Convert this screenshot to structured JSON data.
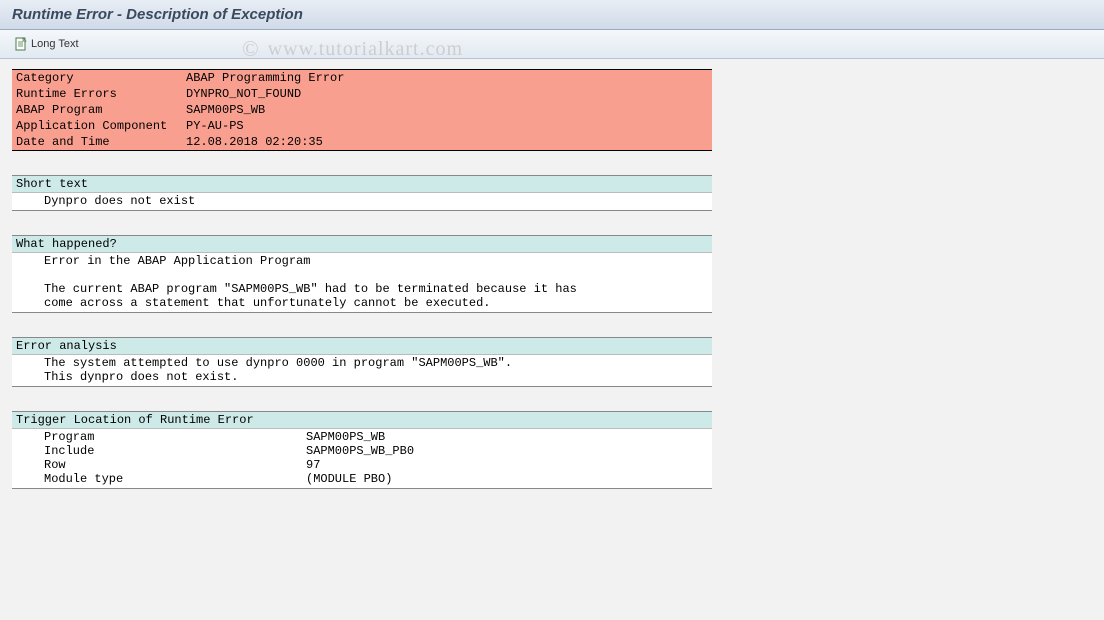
{
  "title": "Runtime Error - Description of Exception",
  "toolbar": {
    "longText": "Long Text"
  },
  "watermark": "www.tutorialkart.com",
  "info": {
    "rows": [
      {
        "label": "Category",
        "value": "ABAP Programming Error"
      },
      {
        "label": "Runtime Errors",
        "value": "DYNPRO_NOT_FOUND"
      },
      {
        "label": "ABAP Program",
        "value": "SAPM00PS_WB"
      },
      {
        "label": "Application Component",
        "value": "PY-AU-PS"
      },
      {
        "label": "Date and Time",
        "value": "12.08.2018 02:20:35"
      }
    ]
  },
  "sections": {
    "shortText": {
      "header": "Short text",
      "body": "Dynpro does not exist"
    },
    "whatHappened": {
      "header": "What happened?",
      "line1": "Error in the ABAP Application Program",
      "line2": "The current ABAP program \"SAPM00PS_WB\" had to be terminated because it has",
      "line3": "come across a statement that unfortunately cannot be executed."
    },
    "errorAnalysis": {
      "header": "Error analysis",
      "line1": "The system attempted to use dynpro 0000 in program \"SAPM00PS_WB\".",
      "line2": "This dynpro does not exist."
    },
    "trigger": {
      "header": "Trigger Location of Runtime Error",
      "rows": [
        {
          "label": "Program",
          "value": "SAPM00PS_WB"
        },
        {
          "label": "Include",
          "value": "SAPM00PS_WB_PB0"
        },
        {
          "label": "Row",
          "value": "97"
        },
        {
          "label": "Module type",
          "value": "(MODULE PBO)"
        }
      ]
    }
  }
}
